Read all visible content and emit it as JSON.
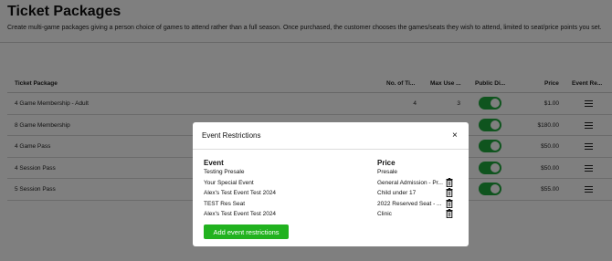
{
  "page": {
    "title": "Ticket Packages",
    "description": "Create multi-game packages giving a person choice of games to attend rather than a full season. Once purchased, the customer chooses the games/seats they wish to attend, limited to seat/price points you set."
  },
  "table": {
    "headers": {
      "name": "Ticket Package",
      "num_tickets": "No. of Ti...",
      "max_use": "Max Use ...",
      "public_display": "Public Di...",
      "price": "Price",
      "event_restrictions": "Event Re..."
    },
    "rows": [
      {
        "name": "4 Game Membership - Adult",
        "num_tickets": "4",
        "max_use": "3",
        "public": true,
        "price": "$1.00"
      },
      {
        "name": "8 Game Membership",
        "num_tickets": "",
        "max_use": "",
        "public": true,
        "price": "$180.00"
      },
      {
        "name": "4 Game Pass",
        "num_tickets": "",
        "max_use": "",
        "public": true,
        "price": "$50.00"
      },
      {
        "name": "4 Session Pass",
        "num_tickets": "",
        "max_use": "",
        "public": true,
        "price": "$50.00"
      },
      {
        "name": "5 Session Pass",
        "num_tickets": "",
        "max_use": "",
        "public": true,
        "price": "$55.00"
      }
    ]
  },
  "modal": {
    "title": "Event Restrictions",
    "close_label": "×",
    "event_header": "Event",
    "price_header": "Price",
    "restrictions": [
      {
        "event": "Testing Presale",
        "price": "Presale",
        "has_delete": false
      },
      {
        "event": "Your Special Event",
        "price": "General Admission - Pr...",
        "has_delete": true
      },
      {
        "event": "Alex's Test Event Test 2024",
        "price": "Child under 17",
        "has_delete": true
      },
      {
        "event": "TEST Res Seat",
        "price": "2022 Reserved Seat - ...",
        "has_delete": true
      },
      {
        "event": "Alex's Test Event Test 2024",
        "price": "Clinic",
        "has_delete": true
      }
    ],
    "add_button_label": "Add event restrictions"
  },
  "colors": {
    "toggle_on": "#1fa83c",
    "add_button": "#21b21f",
    "overlay": "rgba(0,0,0,0.5)"
  }
}
